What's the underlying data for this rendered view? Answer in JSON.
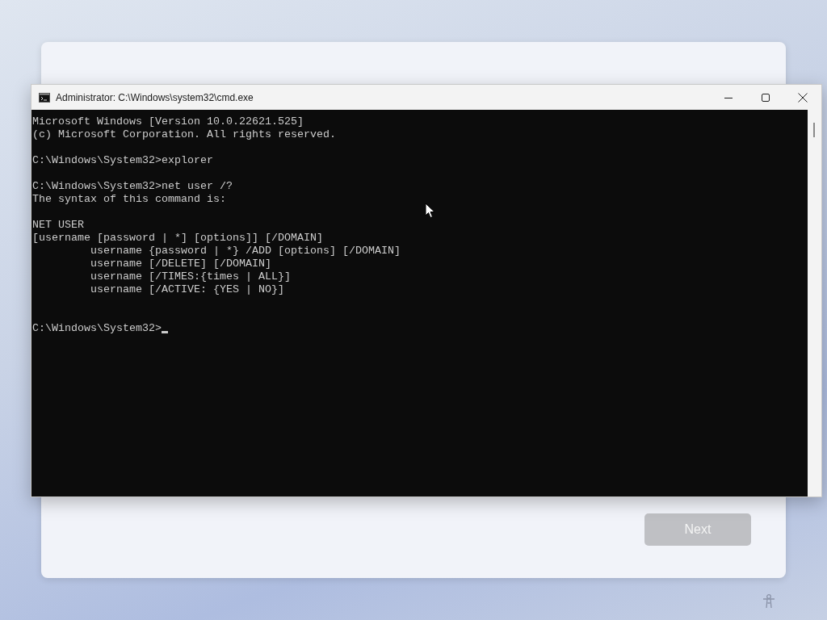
{
  "setup_card": {
    "next_button": {
      "label": "Next",
      "disabled": true
    }
  },
  "window": {
    "title": "Administrator: C:\\Windows\\system32\\cmd.exe"
  },
  "console": {
    "blocks": [
      {
        "kind": "output",
        "lines": [
          "Microsoft Windows [Version 10.0.22621.525]",
          "(c) Microsoft Corporation. All rights reserved."
        ]
      },
      {
        "kind": "output",
        "lines": [
          "C:\\Windows\\System32>explorer"
        ]
      },
      {
        "kind": "output",
        "lines": [
          "C:\\Windows\\System32>net user /?",
          "The syntax of this command is:"
        ]
      },
      {
        "kind": "output",
        "lines": [
          "NET USER",
          "[username [password | *] [options]] [/DOMAIN]",
          "         username {password | *} /ADD [options] [/DOMAIN]",
          "         username [/DELETE] [/DOMAIN]",
          "         username [/TIMES:{times | ALL}]",
          "         username [/ACTIVE: {YES | NO}]"
        ]
      },
      {
        "kind": "prompt",
        "lines": [
          "C:\\Windows\\System32>"
        ],
        "cursor": true
      }
    ]
  }
}
